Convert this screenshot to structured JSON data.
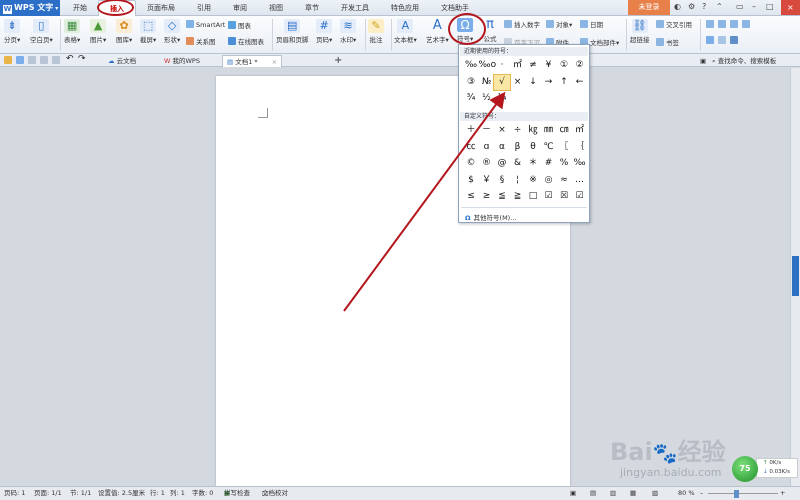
{
  "app": {
    "logo_text": "WPS 文字",
    "login_label": "未登录"
  },
  "menu": {
    "tabs": [
      "开始",
      "插入",
      "页面布局",
      "引用",
      "审阅",
      "视图",
      "章节",
      "开发工具",
      "特色应用",
      "文档助手"
    ],
    "active": "插入"
  },
  "ribbon": {
    "pagination": "分页",
    "blank_page": "空白页",
    "table": "表格",
    "picture": "图片",
    "gallery": "图库",
    "screenshot": "截屏",
    "shapes": "形状",
    "smartart": "SmartArt",
    "relation": "关系图",
    "chart": "图表",
    "online_chart": "在线图表",
    "header_footer": "页眉和页脚",
    "page_number": "页码",
    "watermark": "水印",
    "annotation": "批注",
    "textbox": "文本框",
    "wordart": "艺术字",
    "symbol": "符号",
    "formula": "公式",
    "insert_number": "插入数字",
    "object": "对象",
    "date": "日期",
    "first_drop_cap": "首字下沉",
    "attachment": "附件",
    "doc_parts": "文档部件",
    "hyperlink": "超链接",
    "cross_ref": "交叉引用",
    "bookmark": "书签"
  },
  "tabbar": {
    "tabs": [
      "云文档",
      "我的WPS",
      "文档1 *"
    ],
    "find_label": "查找命令、搜索模板"
  },
  "symbol_dropdown": {
    "recent_header": "近期使用的符号：",
    "custom_header": "自定义符号：",
    "recent": [
      "‰",
      "‰o",
      "·",
      "㎡",
      "≠",
      "¥",
      "①",
      "②",
      "③",
      "№",
      "√",
      "×",
      "↓",
      "→",
      "↑",
      "←",
      "¾",
      "½",
      "¼"
    ],
    "custom": [
      "＋",
      "－",
      "×",
      "÷",
      "㎏",
      "㎜",
      "㎝",
      "㎡",
      "㏄",
      "ɑ",
      "α",
      "β",
      "θ",
      "℃",
      "〖",
      "｛",
      "©",
      "®",
      "@",
      "&",
      "＊",
      "#",
      "%",
      "‰",
      "$",
      "￥",
      "§",
      "¦",
      "※",
      "◎",
      "≈",
      "…",
      "≤",
      "≥",
      "≦",
      "≧",
      "□",
      "☑",
      "☒",
      "☑"
    ],
    "highlighted": "√",
    "other_symbols": "其他符号(M)..."
  },
  "status": {
    "page_no": "页码: 1",
    "pages": "页面: 1/1",
    "section": "节: 1/1",
    "setting": "设置值: 2.5厘米",
    "row": "行: 1",
    "col": "列: 1",
    "words": "字数: 0",
    "spell": "拼写检查",
    "doc_check": "文档校对",
    "zoom": "80 %"
  },
  "watermark_site": "jingyan.baidu.com",
  "netmon": {
    "percent": "75",
    "up": "0K/s",
    "down": "0.03K/s"
  },
  "colors": {
    "accent_blue": "#2b6fc8",
    "annotation_red": "#b3161c",
    "highlight": "#fbe7a5"
  }
}
